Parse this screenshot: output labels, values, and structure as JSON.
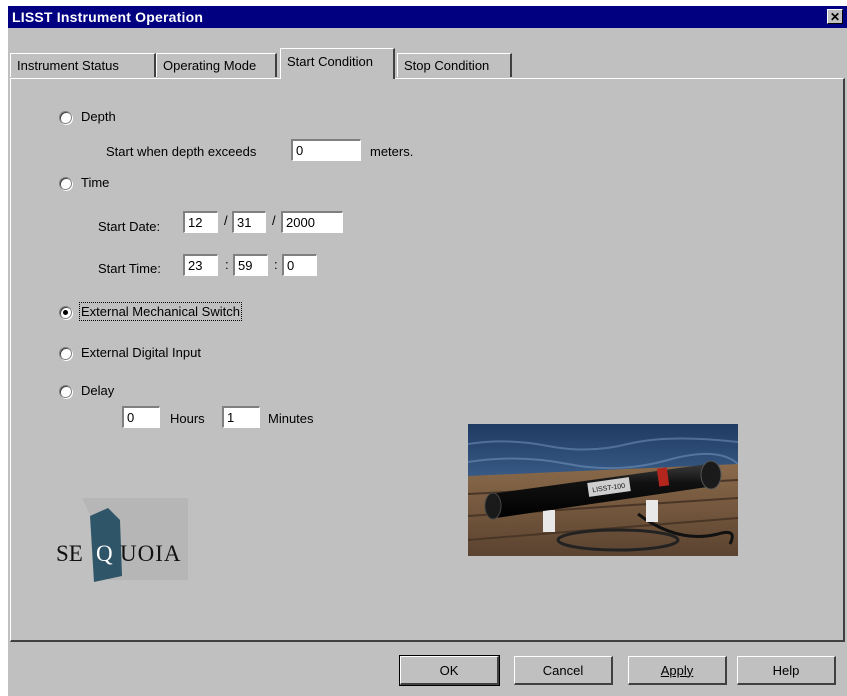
{
  "window": {
    "title": "LISST Instrument Operation",
    "close_glyph": "✕"
  },
  "tabs": [
    "Instrument Status",
    "Operating Mode",
    "Start Condition",
    "Stop Condition"
  ],
  "start_condition": {
    "depth": {
      "label": "Depth",
      "prompt": "Start when depth exceeds",
      "value": "0",
      "unit": "meters."
    },
    "time": {
      "label": "Time",
      "start_date_label": "Start Date:",
      "month": "12",
      "day": "31",
      "year": "2000",
      "start_time_label": "Start Time:",
      "hour": "23",
      "minute": "59",
      "second": "0",
      "date_sep": "/",
      "time_sep": ":"
    },
    "external_mechanical_switch": {
      "label": "External Mechanical Switch",
      "selected": true
    },
    "external_digital_input": {
      "label": "External Digital Input"
    },
    "delay": {
      "label": "Delay",
      "hours_value": "0",
      "hours_label": "Hours",
      "minutes_value": "1",
      "minutes_label": "Minutes"
    }
  },
  "logo": {
    "text_se": "SE",
    "text_q": "Q",
    "text_uoia": "UOIA"
  },
  "photo": {
    "device_label": "LISST-100"
  },
  "buttons": {
    "ok": "OK",
    "cancel": "Cancel",
    "apply": "Apply",
    "help": "Help"
  },
  "icons": {
    "close": "close-icon",
    "radio": "radio-icon"
  },
  "colors": {
    "titlebar": "#000080",
    "face": "#c0c0c0",
    "logo_q": "#2f5568"
  }
}
